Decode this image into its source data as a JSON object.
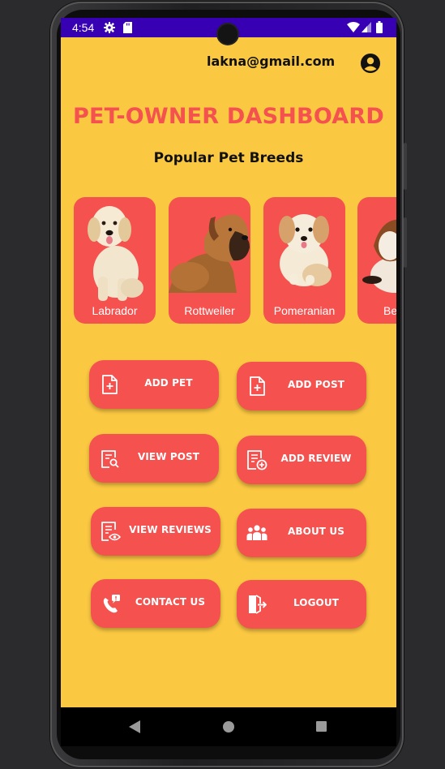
{
  "status_bar": {
    "time": "4:54",
    "icons": [
      "gear-icon",
      "sd-card-icon",
      "wifi-icon",
      "signal-icon",
      "battery-icon"
    ],
    "color": "#3700b3"
  },
  "header": {
    "email": "lakna@gmail.com",
    "account_icon": "account-circle-icon"
  },
  "title": "PET-OWNER DASHBOARD",
  "subtitle": "Popular Pet Breeds",
  "breeds": [
    {
      "label": "Labrador"
    },
    {
      "label": "Rottweiler"
    },
    {
      "label": "Pomeranian"
    },
    {
      "label": "Bea"
    }
  ],
  "actions": [
    {
      "label": "ADD PET",
      "icon": "add-file-icon"
    },
    {
      "label": "ADD POST",
      "icon": "add-file-icon"
    },
    {
      "label": "VIEW POST",
      "icon": "search-document-icon"
    },
    {
      "label": "ADD REVIEW",
      "icon": "document-add-icon"
    },
    {
      "label": "VIEW REVIEWS",
      "icon": "document-view-icon"
    },
    {
      "label": "ABOUT US",
      "icon": "group-icon"
    },
    {
      "label": "CONTACT US",
      "icon": "phone-icon"
    },
    {
      "label": "LOGOUT",
      "icon": "logout-icon"
    }
  ],
  "nav_bar": {
    "back_icon": "back-triangle-icon",
    "home_icon": "home-circle-icon",
    "recents_icon": "recents-square-icon"
  },
  "colors": {
    "background": "#fbc842",
    "accent": "#f4514f",
    "text": "#111111"
  }
}
